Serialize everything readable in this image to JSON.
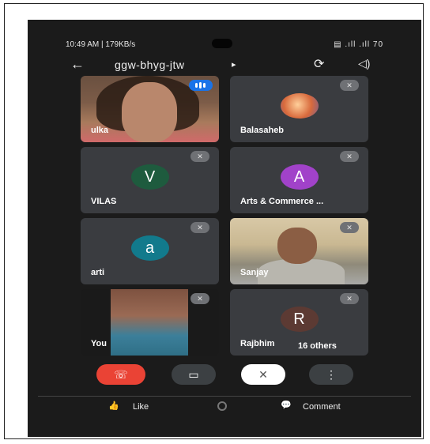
{
  "status_bar": {
    "time": "10:49 AM | 179KB/s",
    "right": "▤ .ıll .ıll 70"
  },
  "header": {
    "back_icon": "←",
    "title": "ggw-bhyg-jtw",
    "dropdown_icon": "▸",
    "camera_switch_icon": "⟳",
    "speaker_icon": "◁)"
  },
  "participants": [
    {
      "name": "ulka",
      "avatar": "",
      "speaking": true
    },
    {
      "name": "Balasaheb",
      "avatar": "",
      "muted": true
    },
    {
      "name": "VILAS",
      "avatar": "V",
      "color": "#1e5b3e",
      "muted": true
    },
    {
      "name": "Arts & Commerce ...",
      "avatar": "A",
      "color": "#a142c9",
      "muted": true
    },
    {
      "name": "arti",
      "avatar": "a",
      "color": "#127a8c",
      "muted": true
    },
    {
      "name": "Sanjay",
      "avatar": "",
      "muted": true
    },
    {
      "name": "You",
      "avatar": "",
      "muted": true
    },
    {
      "name": "Rajbhim",
      "avatar": "R",
      "color": "#5c3a33",
      "muted": true
    }
  ],
  "others_label": "16 others",
  "mute_icon": "✕",
  "controls": {
    "end_call": "☏",
    "camera": "▭",
    "mic": "✕",
    "more": "⋮"
  },
  "bottom_bar": {
    "like_label": "Like",
    "comment_label": "Comment",
    "like_icon": "👍",
    "comment_icon": "💬"
  }
}
